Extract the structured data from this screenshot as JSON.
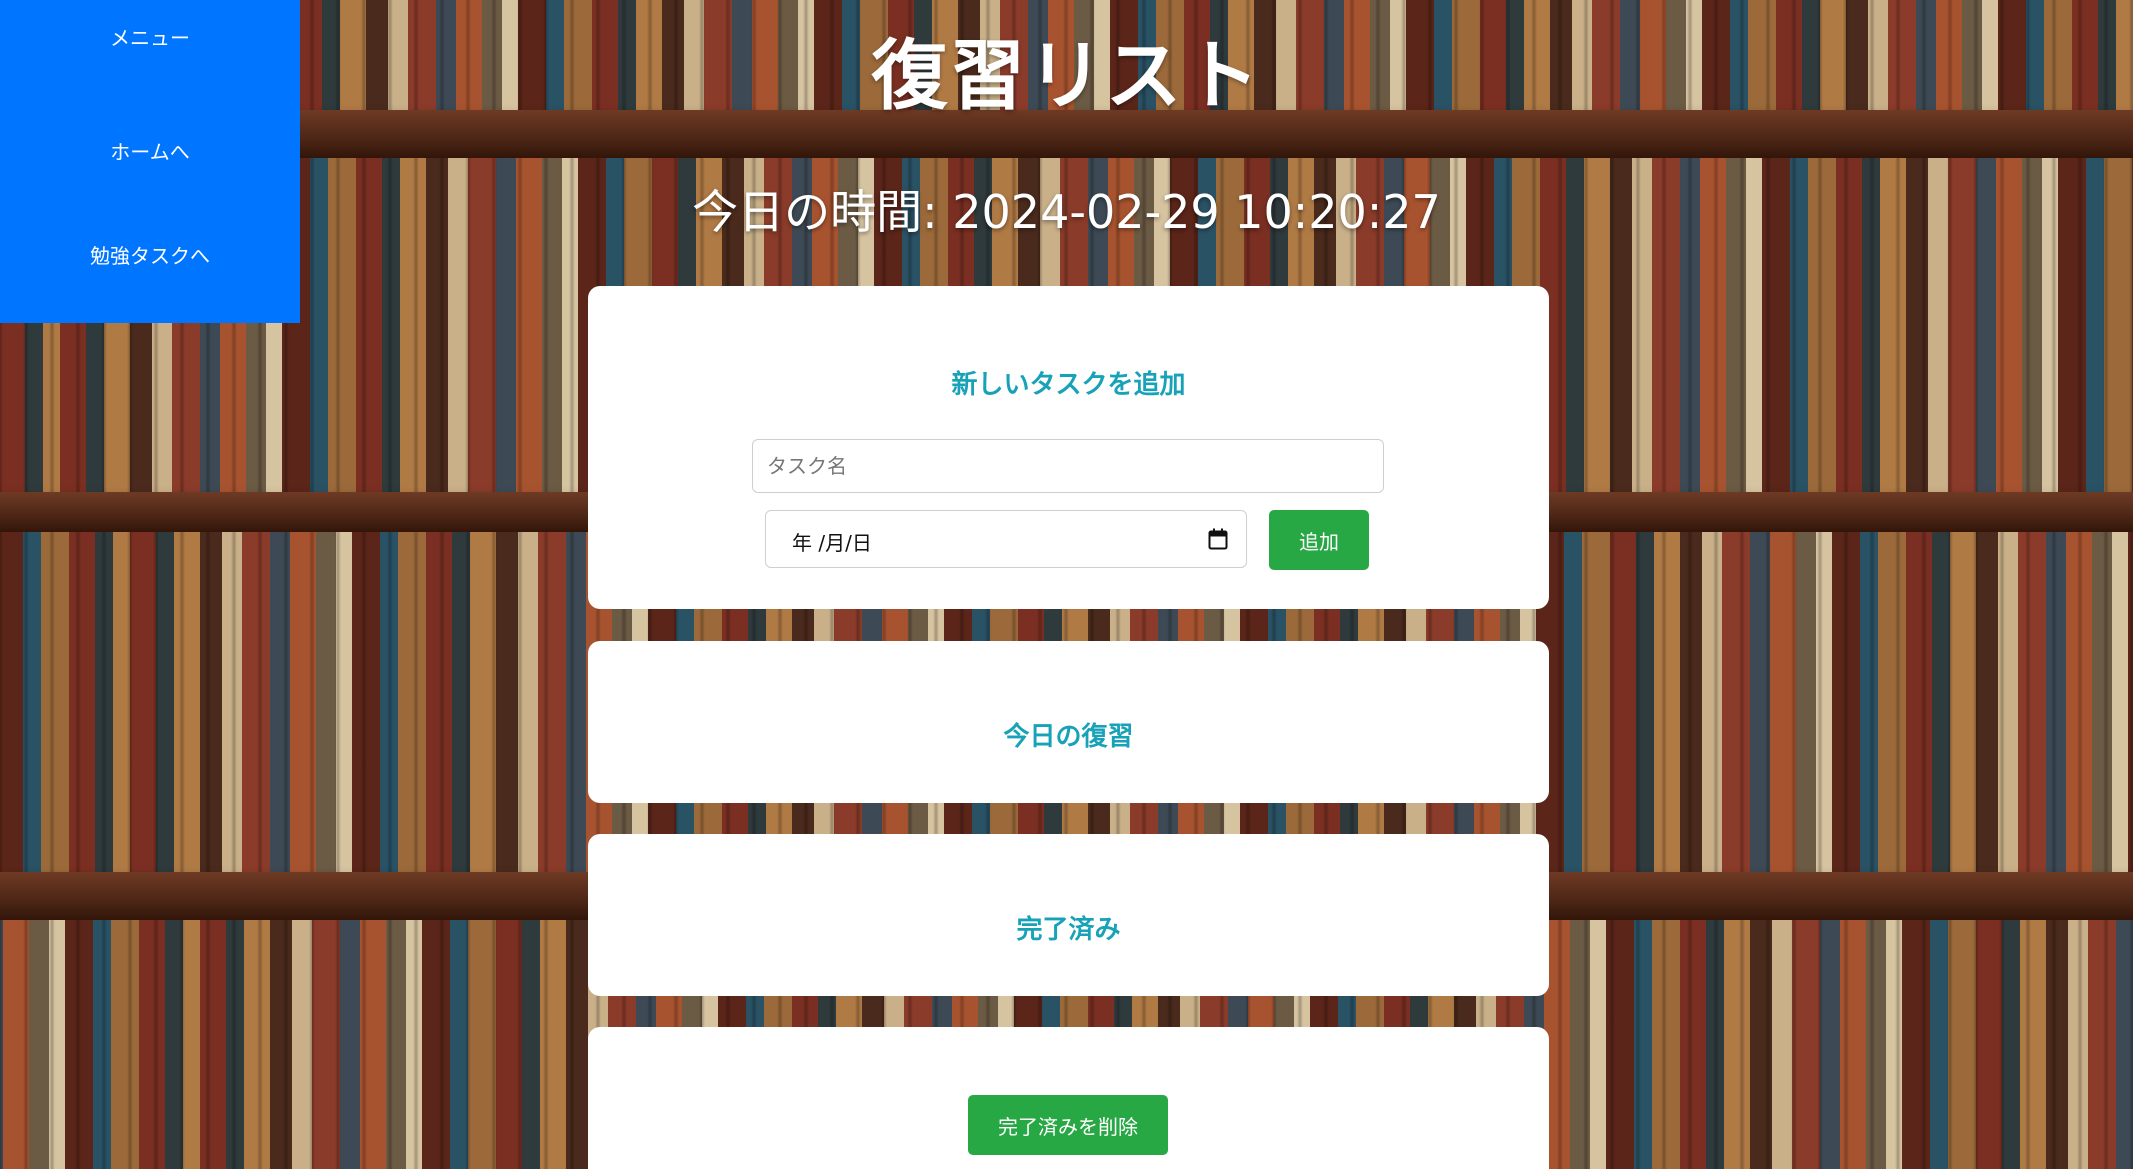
{
  "menu": {
    "title": "メニュー",
    "links": [
      {
        "label": "ホームへ"
      },
      {
        "label": "勉強タスクへ"
      }
    ]
  },
  "page": {
    "title": "復習リスト",
    "clock_label": "今日の時間: 2024-02-29 10:20:27"
  },
  "add_section": {
    "heading": "新しいタスクを追加",
    "task_placeholder": "タスク名",
    "task_value": "",
    "date_display": "年 /月/日",
    "add_button_label": "追加"
  },
  "today_section": {
    "heading": "今日の復習"
  },
  "done_section": {
    "heading": "完了済み"
  },
  "actions": {
    "clear_done_label": "完了済みを削除"
  },
  "colors": {
    "menu_background": "#0075ff",
    "heading_accent": "#17a2b8",
    "button_green": "#28a745"
  },
  "icons": {
    "date_picker": "calendar-icon"
  }
}
